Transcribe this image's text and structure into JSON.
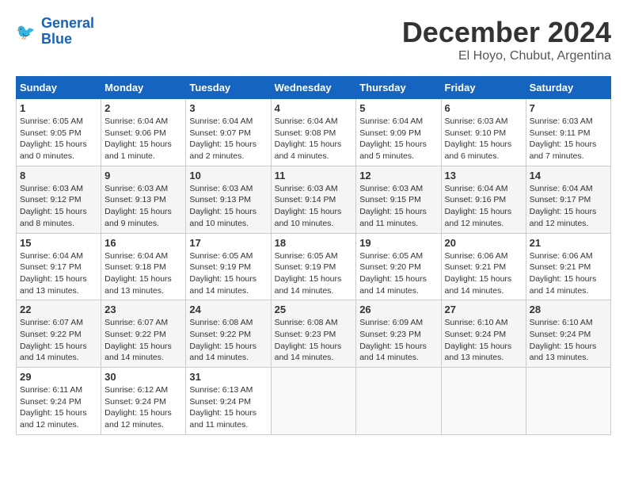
{
  "header": {
    "logo_general": "General",
    "logo_blue": "Blue",
    "title": "December 2024",
    "subtitle": "El Hoyo, Chubut, Argentina"
  },
  "calendar": {
    "days_of_week": [
      "Sunday",
      "Monday",
      "Tuesday",
      "Wednesday",
      "Thursday",
      "Friday",
      "Saturday"
    ],
    "weeks": [
      [
        {
          "day": "1",
          "info": "Sunrise: 6:05 AM\nSunset: 9:05 PM\nDaylight: 15 hours and 0 minutes."
        },
        {
          "day": "2",
          "info": "Sunrise: 6:04 AM\nSunset: 9:06 PM\nDaylight: 15 hours and 1 minute."
        },
        {
          "day": "3",
          "info": "Sunrise: 6:04 AM\nSunset: 9:07 PM\nDaylight: 15 hours and 2 minutes."
        },
        {
          "day": "4",
          "info": "Sunrise: 6:04 AM\nSunset: 9:08 PM\nDaylight: 15 hours and 4 minutes."
        },
        {
          "day": "5",
          "info": "Sunrise: 6:04 AM\nSunset: 9:09 PM\nDaylight: 15 hours and 5 minutes."
        },
        {
          "day": "6",
          "info": "Sunrise: 6:03 AM\nSunset: 9:10 PM\nDaylight: 15 hours and 6 minutes."
        },
        {
          "day": "7",
          "info": "Sunrise: 6:03 AM\nSunset: 9:11 PM\nDaylight: 15 hours and 7 minutes."
        }
      ],
      [
        {
          "day": "8",
          "info": "Sunrise: 6:03 AM\nSunset: 9:12 PM\nDaylight: 15 hours and 8 minutes."
        },
        {
          "day": "9",
          "info": "Sunrise: 6:03 AM\nSunset: 9:13 PM\nDaylight: 15 hours and 9 minutes."
        },
        {
          "day": "10",
          "info": "Sunrise: 6:03 AM\nSunset: 9:13 PM\nDaylight: 15 hours and 10 minutes."
        },
        {
          "day": "11",
          "info": "Sunrise: 6:03 AM\nSunset: 9:14 PM\nDaylight: 15 hours and 10 minutes."
        },
        {
          "day": "12",
          "info": "Sunrise: 6:03 AM\nSunset: 9:15 PM\nDaylight: 15 hours and 11 minutes."
        },
        {
          "day": "13",
          "info": "Sunrise: 6:04 AM\nSunset: 9:16 PM\nDaylight: 15 hours and 12 minutes."
        },
        {
          "day": "14",
          "info": "Sunrise: 6:04 AM\nSunset: 9:17 PM\nDaylight: 15 hours and 12 minutes."
        }
      ],
      [
        {
          "day": "15",
          "info": "Sunrise: 6:04 AM\nSunset: 9:17 PM\nDaylight: 15 hours and 13 minutes."
        },
        {
          "day": "16",
          "info": "Sunrise: 6:04 AM\nSunset: 9:18 PM\nDaylight: 15 hours and 13 minutes."
        },
        {
          "day": "17",
          "info": "Sunrise: 6:05 AM\nSunset: 9:19 PM\nDaylight: 15 hours and 14 minutes."
        },
        {
          "day": "18",
          "info": "Sunrise: 6:05 AM\nSunset: 9:19 PM\nDaylight: 15 hours and 14 minutes."
        },
        {
          "day": "19",
          "info": "Sunrise: 6:05 AM\nSunset: 9:20 PM\nDaylight: 15 hours and 14 minutes."
        },
        {
          "day": "20",
          "info": "Sunrise: 6:06 AM\nSunset: 9:21 PM\nDaylight: 15 hours and 14 minutes."
        },
        {
          "day": "21",
          "info": "Sunrise: 6:06 AM\nSunset: 9:21 PM\nDaylight: 15 hours and 14 minutes."
        }
      ],
      [
        {
          "day": "22",
          "info": "Sunrise: 6:07 AM\nSunset: 9:22 PM\nDaylight: 15 hours and 14 minutes."
        },
        {
          "day": "23",
          "info": "Sunrise: 6:07 AM\nSunset: 9:22 PM\nDaylight: 15 hours and 14 minutes."
        },
        {
          "day": "24",
          "info": "Sunrise: 6:08 AM\nSunset: 9:22 PM\nDaylight: 15 hours and 14 minutes."
        },
        {
          "day": "25",
          "info": "Sunrise: 6:08 AM\nSunset: 9:23 PM\nDaylight: 15 hours and 14 minutes."
        },
        {
          "day": "26",
          "info": "Sunrise: 6:09 AM\nSunset: 9:23 PM\nDaylight: 15 hours and 14 minutes."
        },
        {
          "day": "27",
          "info": "Sunrise: 6:10 AM\nSunset: 9:24 PM\nDaylight: 15 hours and 13 minutes."
        },
        {
          "day": "28",
          "info": "Sunrise: 6:10 AM\nSunset: 9:24 PM\nDaylight: 15 hours and 13 minutes."
        }
      ],
      [
        {
          "day": "29",
          "info": "Sunrise: 6:11 AM\nSunset: 9:24 PM\nDaylight: 15 hours and 12 minutes."
        },
        {
          "day": "30",
          "info": "Sunrise: 6:12 AM\nSunset: 9:24 PM\nDaylight: 15 hours and 12 minutes."
        },
        {
          "day": "31",
          "info": "Sunrise: 6:13 AM\nSunset: 9:24 PM\nDaylight: 15 hours and 11 minutes."
        },
        {
          "day": "",
          "info": ""
        },
        {
          "day": "",
          "info": ""
        },
        {
          "day": "",
          "info": ""
        },
        {
          "day": "",
          "info": ""
        }
      ]
    ]
  }
}
